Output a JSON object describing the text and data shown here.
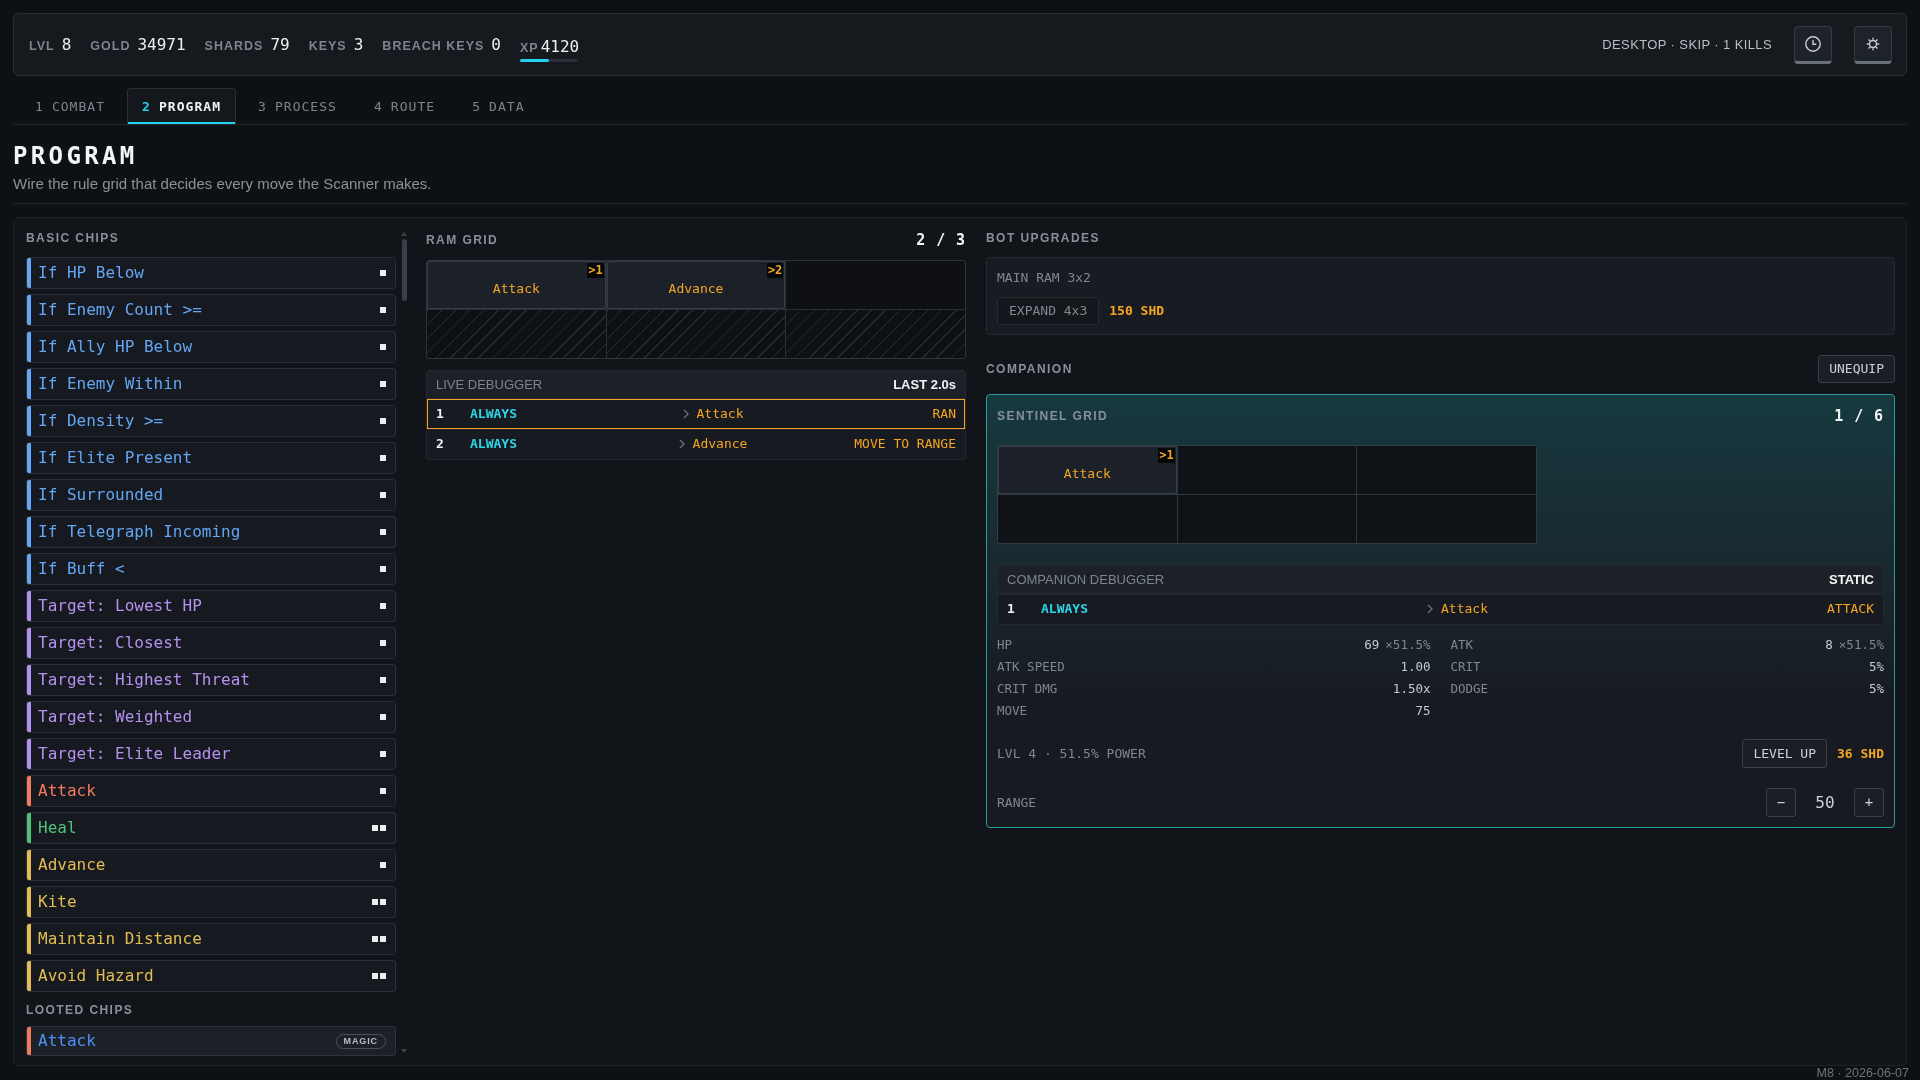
{
  "stats": [
    {
      "label": "LVL",
      "value": "8"
    },
    {
      "label": "GOLD",
      "value": "34971"
    },
    {
      "label": "SHARDS",
      "value": "79"
    },
    {
      "label": "KEYS",
      "value": "3"
    },
    {
      "label": "BREACH KEYS",
      "value": "0"
    }
  ],
  "xp": {
    "label": "XP",
    "value": "4120",
    "level": 0.5
  },
  "session": "DESKTOP · SKIP · 1 KILLS",
  "tabs": [
    {
      "number": "1",
      "label": "COMBAT",
      "selected": false
    },
    {
      "number": "2",
      "label": "PROGRAM",
      "selected": true
    },
    {
      "number": "3",
      "label": "PROCESS",
      "selected": false
    },
    {
      "number": "4",
      "label": "ROUTE",
      "selected": false
    },
    {
      "number": "5",
      "label": "DATA",
      "selected": false
    }
  ],
  "page": {
    "title": "PROGRAM",
    "subtitle": "Wire the rule grid that decides every move the Scanner makes."
  },
  "basic_chips": {
    "title": "BASIC CHIPS",
    "items": [
      {
        "label": "If HP Below",
        "color": "#63a6f2",
        "wide": false
      },
      {
        "label": "If Enemy Count >=",
        "color": "#63a6f2",
        "wide": false
      },
      {
        "label": "If Ally HP Below",
        "color": "#63a6f2",
        "wide": false
      },
      {
        "label": "If Enemy Within",
        "color": "#63a6f2",
        "wide": false
      },
      {
        "label": "If Density >=",
        "color": "#63a6f2",
        "wide": false
      },
      {
        "label": "If Elite Present",
        "color": "#63a6f2",
        "wide": false
      },
      {
        "label": "If Surrounded",
        "color": "#63a6f2",
        "wide": false
      },
      {
        "label": "If Telegraph Incoming",
        "color": "#63a6f2",
        "wide": false
      },
      {
        "label": "If Buff <",
        "color": "#63a6f2",
        "wide": false
      },
      {
        "label": "Target: Lowest HP",
        "color": "#b591ee",
        "wide": false
      },
      {
        "label": "Target: Closest",
        "color": "#b591ee",
        "wide": false
      },
      {
        "label": "Target: Highest Threat",
        "color": "#b591ee",
        "wide": false
      },
      {
        "label": "Target: Weighted",
        "color": "#b591ee",
        "wide": false
      },
      {
        "label": "Target: Elite Leader",
        "color": "#b591ee",
        "wide": false
      },
      {
        "label": "Attack",
        "color": "#f27a5d",
        "wide": false
      },
      {
        "label": "Heal",
        "color": "#4fc27a",
        "wide": true
      },
      {
        "label": "Advance",
        "color": "#e3bd52",
        "wide": false
      },
      {
        "label": "Kite",
        "color": "#e3bd52",
        "wide": true
      },
      {
        "label": "Maintain Distance",
        "color": "#e3bd52",
        "wide": true
      },
      {
        "label": "Avoid Hazard",
        "color": "#e3bd52",
        "wide": true
      }
    ]
  },
  "looted_chips": {
    "title": "LOOTED CHIPS",
    "items": [
      {
        "label": "Attack",
        "color": "#f27a5d",
        "badge": "MAGIC",
        "kind": "magic"
      }
    ]
  },
  "ram_grid": {
    "title": "RAM GRID",
    "count": "2 / 3",
    "cells": [
      {
        "kind": "chip",
        "label": "Attack",
        "order": ">1"
      },
      {
        "kind": "chip",
        "label": "Advance",
        "order": ">2"
      },
      {
        "kind": "empty"
      },
      {
        "kind": "locked"
      },
      {
        "kind": "locked"
      },
      {
        "kind": "locked"
      }
    ]
  },
  "live_debugger": {
    "title": "LIVE DEBUGGER",
    "window": "LAST 2.0s",
    "rows": [
      {
        "index": "1",
        "condition": "ALWAYS",
        "action": "Attack",
        "result": "RAN",
        "selected": true
      },
      {
        "index": "2",
        "condition": "ALWAYS",
        "action": "Advance",
        "result": "MOVE TO RANGE",
        "selected": false
      }
    ]
  },
  "bot_upgrades": {
    "title": "BOT UPGRADES",
    "ram": "MAIN RAM 3x2",
    "button": "EXPAND 4x3",
    "cost": "150 SHD"
  },
  "companion": {
    "title": "COMPANION",
    "unequip": "UNEQUIP",
    "grid": {
      "title": "SENTINEL GRID",
      "count": "1 / 6",
      "cells": [
        {
          "kind": "chip",
          "label": "Attack",
          "order": ">1"
        },
        {
          "kind": "empty"
        },
        {
          "kind": "empty"
        },
        {
          "kind": "empty"
        },
        {
          "kind": "empty"
        },
        {
          "kind": "empty"
        }
      ]
    },
    "debugger": {
      "title": "COMPANION DEBUGGER",
      "mode": "STATIC",
      "rows": [
        {
          "index": "1",
          "condition": "ALWAYS",
          "action": "Attack",
          "result": "ATTACK",
          "selected": false
        }
      ]
    },
    "stats": [
      {
        "label": "HP",
        "value": "69",
        "multiplier": "×51.5%"
      },
      {
        "label": "ATK",
        "value": "8",
        "multiplier": "×51.5%"
      },
      {
        "label": "ATK SPEED",
        "value": "1.00"
      },
      {
        "label": "CRIT",
        "value": "5%"
      },
      {
        "label": "CRIT DMG",
        "value": "1.50x"
      },
      {
        "label": "DODGE",
        "value": "5%"
      },
      {
        "label": "MOVE",
        "value": "75"
      }
    ],
    "level": {
      "text": "LVL 4 · 51.5% POWER",
      "button": "LEVEL UP",
      "cost": "36 SHD"
    },
    "range": {
      "label": "RANGE",
      "minus": "−",
      "value": "50",
      "plus": "+"
    }
  },
  "footer": "M8 · 2026-06-07"
}
